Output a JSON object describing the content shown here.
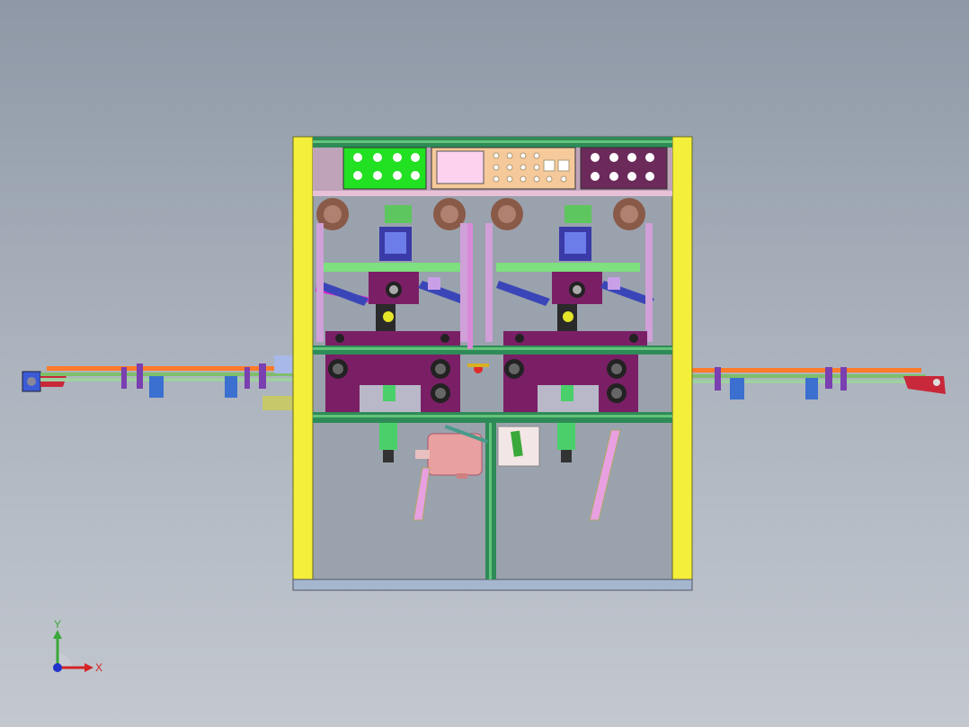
{
  "viewport": {
    "background_top": "#8e98a6",
    "background_bottom": "#c3c8cf"
  },
  "model": {
    "frame_color": "#f3ef3a",
    "rail_color": "#2e8b57",
    "panel_colors": [
      "#22e022",
      "#f6c99a",
      "#6b2a5a"
    ],
    "plate_color": "#7a1f66",
    "motor_color": "#e9a0a0"
  },
  "triad": {
    "x_label": "X",
    "y_label": "Y",
    "x_color": "#d42424",
    "y_color": "#3aa83a"
  }
}
